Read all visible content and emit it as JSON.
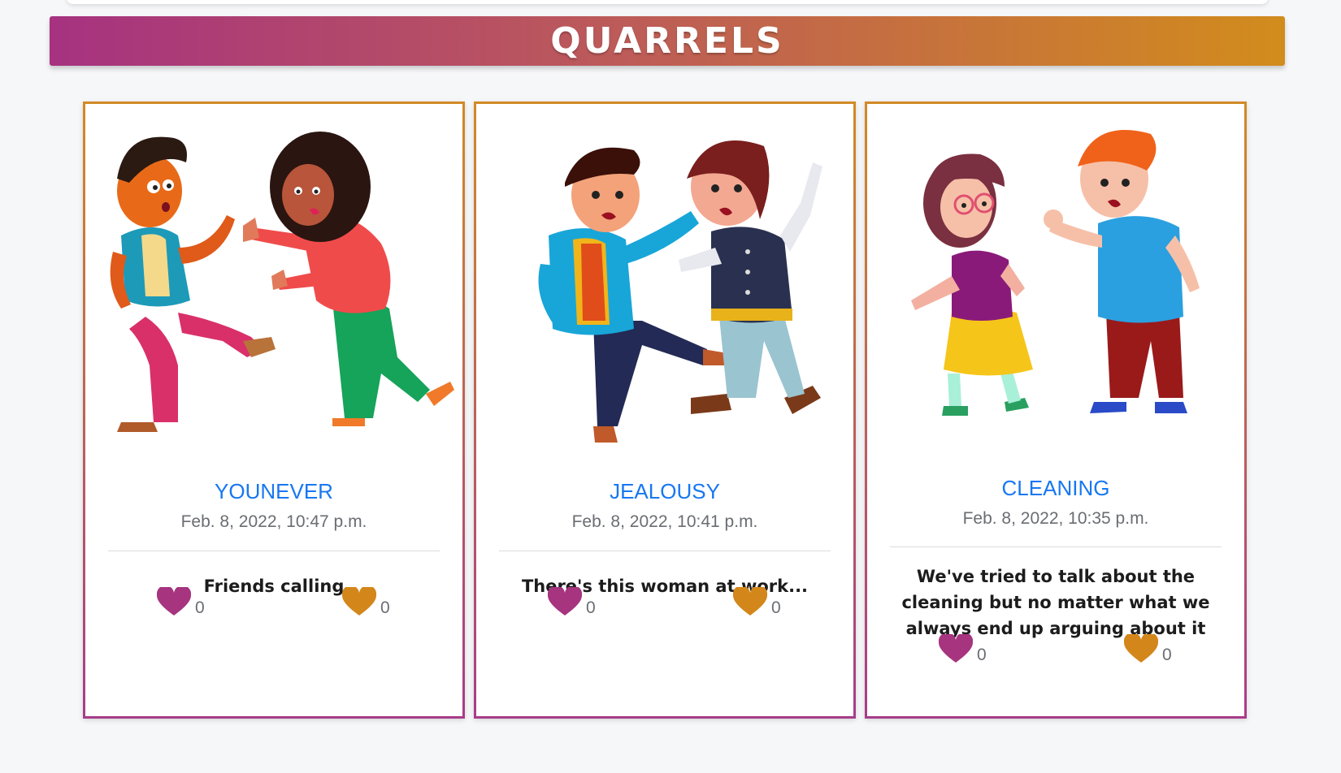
{
  "banner": {
    "title": "QUARRELS"
  },
  "colors": {
    "like": "#a6347f",
    "dislike": "#d3861a",
    "title_link": "#1877f2"
  },
  "cards": [
    {
      "title": "YOUNEVER",
      "date": "Feb. 8, 2022, 10:47 p.m.",
      "body": "Friends calling",
      "likes": "0",
      "dislikes": "0",
      "image": "two kids quarreling illustration"
    },
    {
      "title": "JEALOUSY",
      "date": "Feb. 8, 2022, 10:41 p.m.",
      "body": "There's this woman at work...",
      "likes": "0",
      "dislikes": "0",
      "image": "two kids fighting illustration"
    },
    {
      "title": "CLEANING",
      "date": "Feb. 8, 2022, 10:35 p.m.",
      "body": "We've tried to talk about the cleaning but no matter what we always end up arguing about it",
      "likes": "0",
      "dislikes": "0",
      "image": "girl and boy arguing illustration"
    }
  ]
}
